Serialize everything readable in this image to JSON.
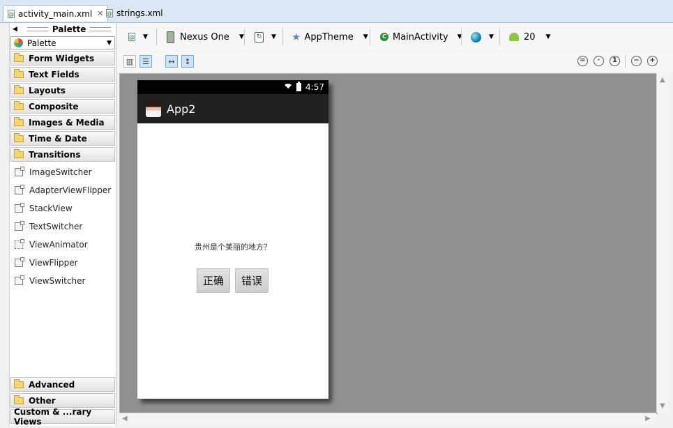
{
  "tabs": [
    {
      "label": "activity_main.xml",
      "active": true
    },
    {
      "label": "strings.xml",
      "active": false
    }
  ],
  "palette": {
    "title": "Palette",
    "selector_value": "Palette",
    "categories_top": [
      "Form Widgets",
      "Text Fields",
      "Layouts",
      "Composite",
      "Images & Media",
      "Time & Date",
      "Transitions"
    ],
    "widgets": [
      "ImageSwitcher",
      "AdapterViewFlipper",
      "StackView",
      "TextSwitcher",
      "ViewAnimator",
      "ViewFlipper",
      "ViewSwitcher"
    ],
    "categories_bottom": [
      "Advanced",
      "Other",
      "Custom & ...rary Views"
    ]
  },
  "toolbar": {
    "device": "Nexus One",
    "theme": "AppTheme",
    "activity": "MainActivity",
    "api_level": "20"
  },
  "device_screen": {
    "time": "4:57",
    "app_title": "App2",
    "question": "贵州是个美丽的地方？",
    "btn_correct": "正确",
    "btn_wrong": "错误"
  },
  "colors": {
    "canvas_bg": "#909090",
    "action_bar": "#212121",
    "tab_bar": "#dde7f3"
  }
}
